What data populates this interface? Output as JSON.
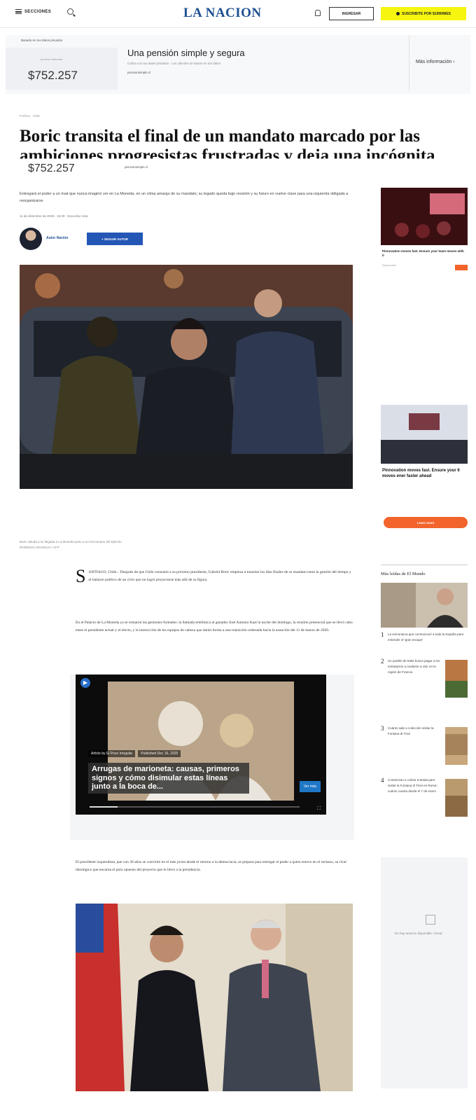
{
  "header": {
    "menu_label": "SECCIONES",
    "logo": "LA NACION",
    "login_label": "INGRESAR",
    "subscribe_label": "SUSCRIBITE POR $1990/MES"
  },
  "ad_top": {
    "small_label": "Basado en tus datos privados",
    "tiny_label": "pensión estimada",
    "price": "$752.257",
    "title": "Una pensión simple y segura",
    "subtitle": "Cotiza con tus datos privados · Los cálculos se basan en tus datos",
    "url": "pensionsimple.cl",
    "more": "Más información"
  },
  "article": {
    "breadcrumb": "Política · Chile",
    "headline": "Boric transita el final de un mandato marcado por las ambiciones progresistas frustradas y deja una incógnita",
    "overlay_price": "$752.257",
    "overlay_url": "pensionsimple.cl",
    "lead": "Entregará el poder a un rival que nunca imaginó ver en La Moneda, en un clima amargo de su mandato; su legado queda bajo revisión y su futuro en vuelve clave para una izquierda obligada a reorganizarse",
    "meta": "11 de diciembre de 2025 · 15:30 · Escuchar nota",
    "author": "Autor Nación",
    "follow_label": "+ SEGUIR AUTOR",
    "caption": "Boric saluda a su llegada a La Moneda junto a un funcionario del Ejército",
    "caption_credit": "RODRIGO ARANGUA / AFP",
    "p1_rest": "ANTIAGO, Chile.– Después de que Chile consumó a su próximo presidente, Gabriel Boric empieza a transitar los días finales de su mandato entre la gestión del tiempo y el balance político de un ciclo que no logró proyectarse más allá de su figura.",
    "p2": "En el Palacio de La Moneda ya se tomaron las gestiones formales: la llamada telefónica al ganador José Antonio Kast la noche del domingo, la reunión presencial que se llevó cabo entre el presidente actual y el electo, y la instrucción de los equipos de cabeza que darán forma a una transición ordenada hacia la asunción del 11 de marzo de 2026.",
    "p3": "El presidente izquierdista, que con 36 años se convirtió en el más joven desde el retorno a la democracia, se prepara para entregar el poder a quien estuvo en el rechazo, su rival ideológico que encarna el polo opuesto del proyecto que lo llevó a la presidencia."
  },
  "video": {
    "author_tag": "Article by El Pozo Irregular",
    "published": "Published Dec 16, 2025",
    "title": "Arrugas de marioneta: causas, primeros signos y cómo disimular estas líneas junto a la boca de...",
    "button": "Ver más"
  },
  "rail": {
    "ad1_title": "Pinnovation moves fast. Ensure your team moves with it",
    "ad1_source": "Sponsored",
    "ad2_title": "Pinnovation moves fast. Ensure your 6 moves ener faster ahead",
    "ad2_button": "Learn more",
    "most_read_title": "Más leídas de El Mundo",
    "ranks": [
      {
        "num": "1",
        "text": "La exmonarca que conmocionó a toda la España para entender el 'gran escape'"
      },
      {
        "num": "2",
        "text": "Un pueblo de Italia busca pagar a los extranjeros a mudarse a vivir en la región de Francia"
      },
      {
        "num": "3",
        "text": "Cuánto sale a colección visitar la Fontana di Trevi"
      },
      {
        "num": "4",
        "text": "Comienzan a cobrar entrada para visitar la Fontana di Trevi en Roma: cuánto cuesta desde el 7 de enero"
      }
    ],
    "ad3_text": "No hay anuncio disponible. Cerrar"
  },
  "colors": {
    "logo": "#1d5091",
    "subscribe_bg": "#f5f50f",
    "follow_bg": "#2356b5",
    "rail_button": "#f2642b"
  }
}
